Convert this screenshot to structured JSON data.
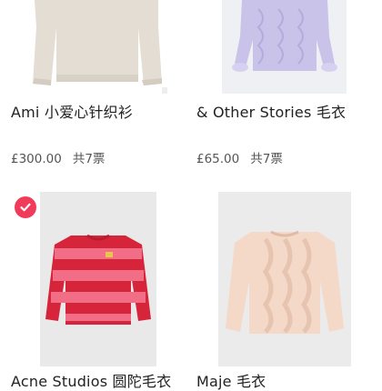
{
  "products": [
    {
      "title": "Ami 小爱心针织衫",
      "price": "£300.00",
      "votes": "共7票",
      "image_icon": "beige-sweater-image",
      "selected": false
    },
    {
      "title": "& Other Stories 毛衣",
      "price": "£65.00",
      "votes": "共7票",
      "image_icon": "lilac-sweater-image",
      "selected": false
    },
    {
      "title": "Acne Studios 圆陀毛衣",
      "price": "",
      "votes": "",
      "image_icon": "red-pink-striped-sweater-image",
      "selected": true
    },
    {
      "title": "Maje 毛衣",
      "price": "",
      "votes": "",
      "image_icon": "peach-cable-knit-sweater-image",
      "selected": false
    }
  ],
  "colors": {
    "accent_check": "#f03c5a",
    "text_primary": "#222222",
    "text_secondary": "#555555"
  },
  "icons": {
    "selected": "checkmark-icon"
  }
}
